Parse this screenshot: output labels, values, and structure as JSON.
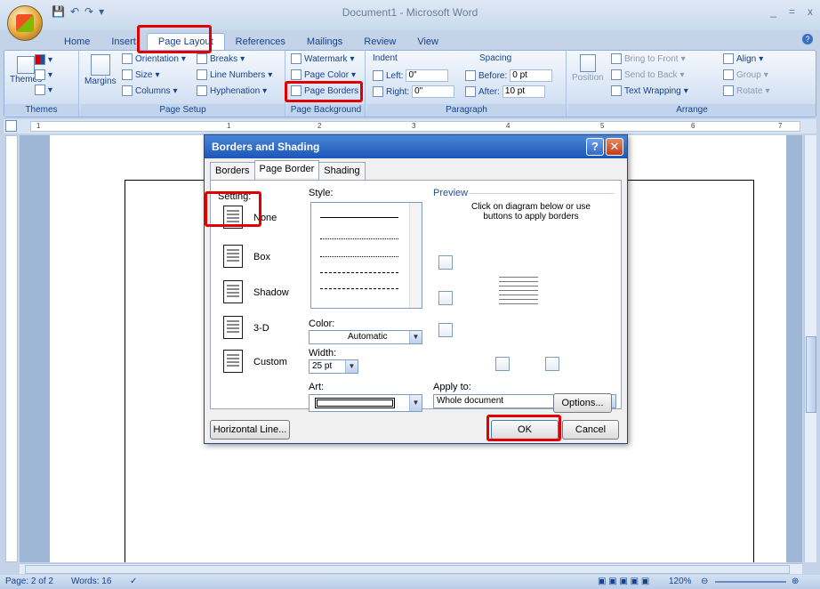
{
  "window": {
    "title": "Document1 - Microsoft Word",
    "minimize": "_",
    "restore": "=",
    "close": "x"
  },
  "quick_access": {
    "save": "💾",
    "undo": "↶",
    "redo": "↷",
    "customize": "▾"
  },
  "tabs": [
    "Home",
    "Insert",
    "Page Layout",
    "References",
    "Mailings",
    "Review",
    "View"
  ],
  "ribbon": {
    "themes": {
      "big": "Themes",
      "label": "Themes"
    },
    "page_setup": {
      "margins": "Margins",
      "orientation": "Orientation",
      "size": "Size",
      "columns": "Columns",
      "breaks": "Breaks",
      "line_numbers": "Line Numbers",
      "hyphenation": "Hyphenation",
      "label": "Page Setup"
    },
    "page_background": {
      "watermark": "Watermark",
      "page_color": "Page Color",
      "page_borders": "Page Borders",
      "label": "Page Background"
    },
    "paragraph": {
      "indent": "Indent",
      "left_label": "Left:",
      "left_value": "0\"",
      "right_label": "Right:",
      "right_value": "0\"",
      "spacing": "Spacing",
      "before_label": "Before:",
      "before_value": "0 pt",
      "after_label": "After:",
      "after_value": "10 pt",
      "label": "Paragraph"
    },
    "arrange": {
      "position": "Position",
      "bring_to_front": "Bring to Front",
      "send_to_back": "Send to Back",
      "text_wrapping": "Text Wrapping",
      "align": "Align",
      "group": "Group",
      "rotate": "Rotate",
      "label": "Arrange"
    }
  },
  "ruler": {
    "numbers": [
      "1",
      "1",
      "2",
      "3",
      "4",
      "5",
      "6",
      "7"
    ]
  },
  "statusbar": {
    "page": "Page: 2 of 2",
    "words": "Words: 16",
    "zoom": "120%"
  },
  "dialog": {
    "title": "Borders and Shading",
    "help": "?",
    "close": "✕",
    "tabs": [
      "Borders",
      "Page Border",
      "Shading"
    ],
    "setting_label": "Setting:",
    "settings": [
      "None",
      "Box",
      "Shadow",
      "3-D",
      "Custom"
    ],
    "style_label": "Style:",
    "color_label": "Color:",
    "color_value": "Automatic",
    "width_label": "Width:",
    "width_value": "25 pt",
    "art_label": "Art:",
    "preview_label": "Preview",
    "preview_hint": "Click on diagram below or use buttons to apply borders",
    "apply_to_label": "Apply to:",
    "apply_to_value": "Whole document",
    "options": "Options...",
    "horizontal_line": "Horizontal Line...",
    "ok": "OK",
    "cancel": "Cancel"
  }
}
